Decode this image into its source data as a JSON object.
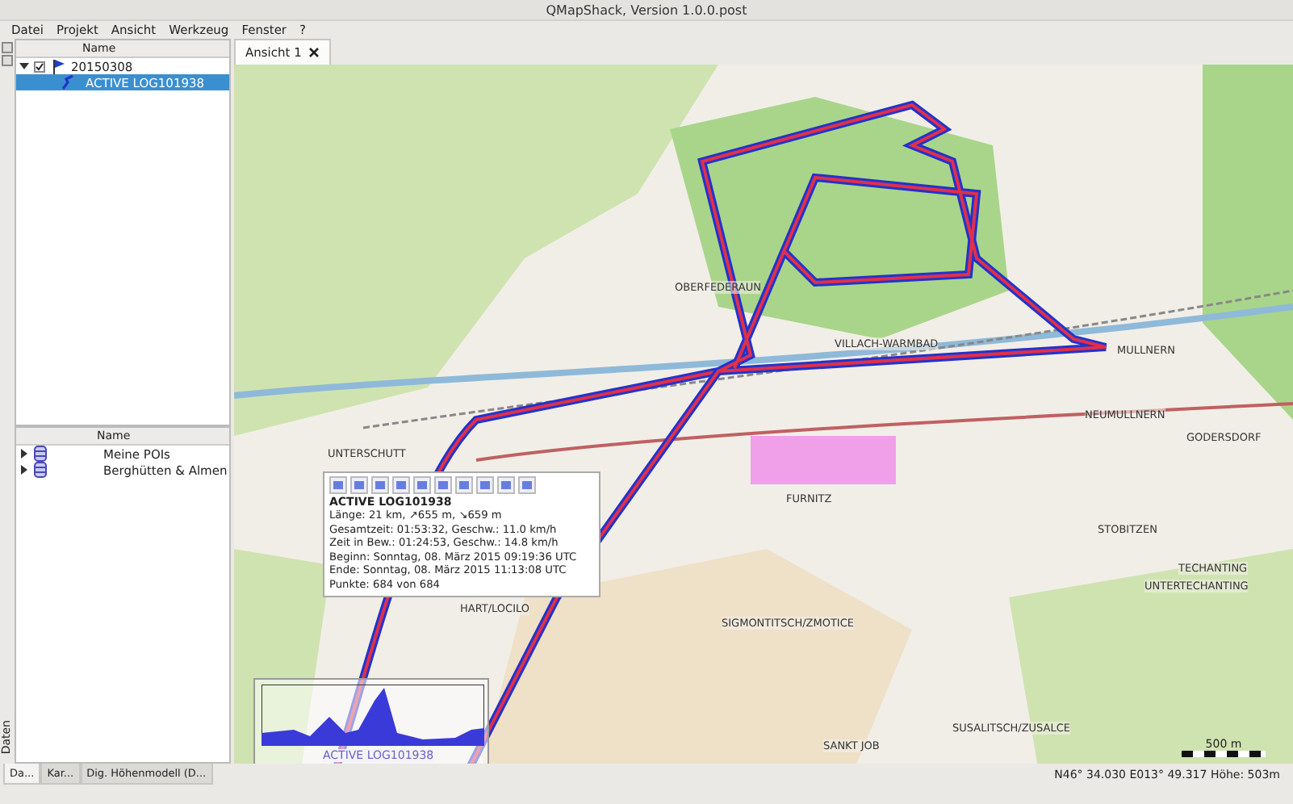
{
  "window": {
    "title": "QMapShack, Version 1.0.0.post"
  },
  "menu": [
    "Datei",
    "Projekt",
    "Ansicht",
    "Werkzeug",
    "Fenster",
    "?"
  ],
  "workspace_tree": {
    "header": "Name",
    "items": [
      {
        "label": "20150308",
        "checked": true,
        "expanded": true,
        "children": [
          {
            "label": "ACTIVE LOG101938",
            "selected": true
          }
        ]
      }
    ]
  },
  "database_tree": {
    "header": "Name",
    "items": [
      {
        "label": "Meine POIs",
        "expanded": false
      },
      {
        "label": "Berghütten & Almen",
        "expanded": false
      }
    ]
  },
  "dock_side_tab": "Daten",
  "dock_tabs": [
    {
      "label": "Da...",
      "selected": true
    },
    {
      "label": "Kar...",
      "selected": false
    },
    {
      "label": "Dig. Höhenmodell (D...",
      "selected": false
    }
  ],
  "view_tabs": [
    {
      "label": "Ansicht 1",
      "selected": true
    }
  ],
  "map": {
    "labels": [
      "OBERFEDERAUN",
      "VILLACH-WARMBAD",
      "MULLNERN",
      "NEUMULLNERN",
      "GODERSDORF",
      "UNTERSCHUTT",
      "FURNITZ",
      "STOBITZEN",
      "TECHANTING",
      "UNTERTECHANTING",
      "HART/LOCILO",
      "SIGMONTITSCH/ZMOTICE",
      "SUSALITSCH/ZUSALCE",
      "SANKT JOB"
    ],
    "track_info": {
      "title": "ACTIVE LOG101938",
      "lines": [
        "Länge: 21 km, ↗655 m, ↘659 m",
        "Gesamtzeit: 01:53:32, Geschw.: 11.0 km/h",
        "Zeit in Bew.: 01:24:53, Geschw.: 14.8 km/h",
        "Beginn: Sonntag, 08. März 2015 09:19:36 UTC",
        "Ende: Sonntag, 08. März 2015 11:13:08 UTC",
        "Punkte: 684 von 684"
      ]
    },
    "profile_label": "ACTIVE LOG101938",
    "scale": "500 m"
  },
  "status_bar": "N46° 34.030 E013° 49.317  Höhe: 503m"
}
